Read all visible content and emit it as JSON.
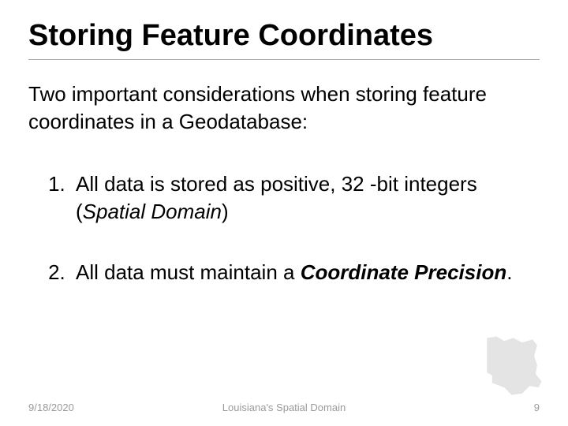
{
  "slide": {
    "title": "Storing Feature Coordinates",
    "intro": "Two important considerations when storing feature coordinates in a Geodatabase:",
    "items": [
      {
        "prefix": "All data is stored as positive, 32 -bit integers (",
        "term": "Spatial Domain",
        "suffix": ")"
      },
      {
        "prefix": "All data must maintain a ",
        "term": "Coordinate Precision",
        "suffix": "."
      }
    ]
  },
  "footer": {
    "date": "9/18/2020",
    "center": "Louisiana's Spatial Domain",
    "page": "9"
  }
}
